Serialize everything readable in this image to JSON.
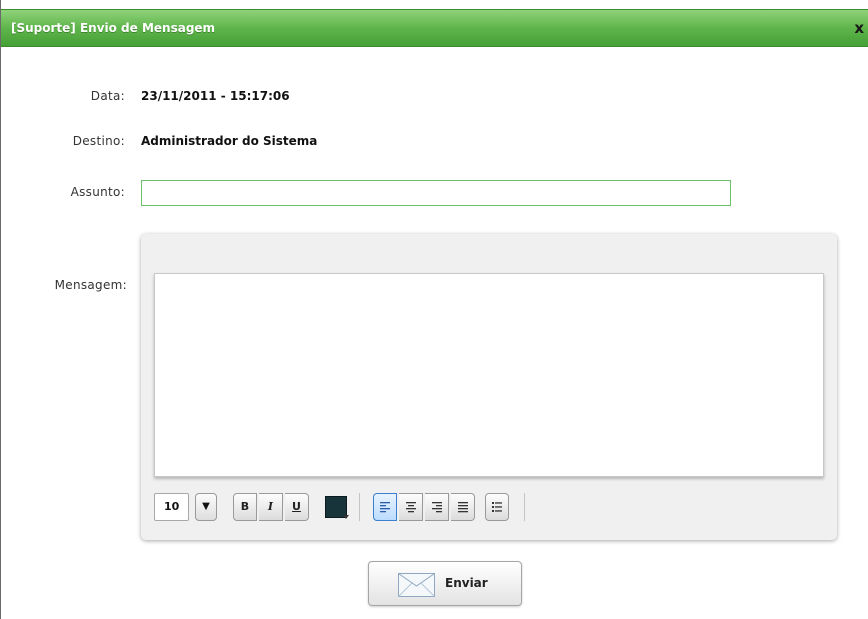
{
  "window": {
    "title": "[Suporte] Envio de Mensagem",
    "close_label": "x"
  },
  "form": {
    "data_label": "Data:",
    "data_value": "23/11/2011 - 15:17:06",
    "destino_label": "Destino:",
    "destino_value": "Administrador do Sistema",
    "assunto_label": "Assunto:",
    "assunto_value": "",
    "mensagem_label": "Mensagem:",
    "mensagem_value": ""
  },
  "toolbar": {
    "font_size": "10",
    "dropdown_glyph": "▼",
    "bold": "B",
    "italic": "I",
    "underline": "U",
    "text_color": "#16343a",
    "icons": [
      "align-left-icon",
      "align-center-icon",
      "align-right-icon",
      "align-justify-icon",
      "bullet-list-icon"
    ]
  },
  "actions": {
    "send_label": "Enviar"
  },
  "colors": {
    "title_bar": "#5fb54b",
    "input_border": "#6cc06a",
    "active_align": "#3a7fd0"
  }
}
